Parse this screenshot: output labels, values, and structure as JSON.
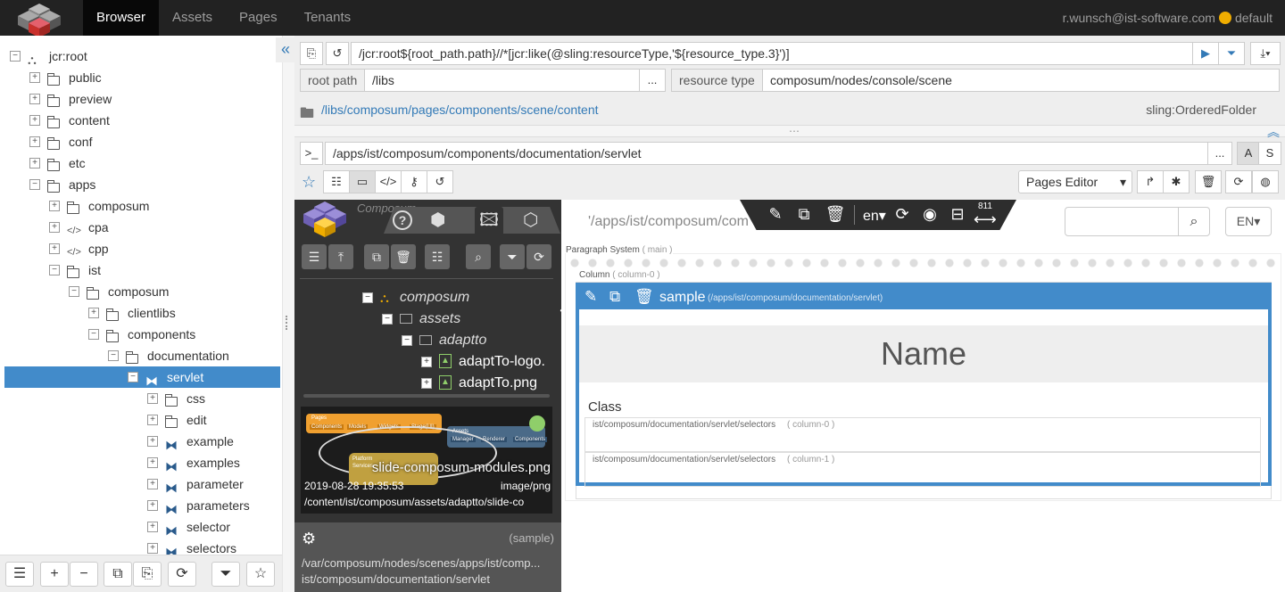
{
  "topnav": {
    "items": [
      "Browser",
      "Assets",
      "Pages",
      "Tenants"
    ],
    "user": "r.wunsch@ist-software.com",
    "tenant": "default"
  },
  "tree": {
    "rows": [
      {
        "label": "jcr:root",
        "depth": 0,
        "toggle": "−",
        "icon": "root-icon"
      },
      {
        "label": "public",
        "depth": 1,
        "toggle": "+",
        "icon": "folder-icon"
      },
      {
        "label": "preview",
        "depth": 1,
        "toggle": "+",
        "icon": "folder-icon"
      },
      {
        "label": "content",
        "depth": 1,
        "toggle": "+",
        "icon": "folder-icon"
      },
      {
        "label": "conf",
        "depth": 1,
        "toggle": "+",
        "icon": "folder-icon"
      },
      {
        "label": "etc",
        "depth": 1,
        "toggle": "+",
        "icon": "folder-icon"
      },
      {
        "label": "apps",
        "depth": 1,
        "toggle": "−",
        "icon": "folder-icon"
      },
      {
        "label": "composum",
        "depth": 2,
        "toggle": "+",
        "icon": "folder-icon"
      },
      {
        "label": "cpa",
        "depth": 2,
        "toggle": "+",
        "icon": "code-icon"
      },
      {
        "label": "cpp",
        "depth": 2,
        "toggle": "+",
        "icon": "code-icon"
      },
      {
        "label": "ist",
        "depth": 2,
        "toggle": "−",
        "icon": "folder-icon"
      },
      {
        "label": "composum",
        "depth": 3,
        "toggle": "−",
        "icon": "folder-icon"
      },
      {
        "label": "clientlibs",
        "depth": 4,
        "toggle": "+",
        "icon": "folder-icon"
      },
      {
        "label": "components",
        "depth": 4,
        "toggle": "−",
        "icon": "folder-icon"
      },
      {
        "label": "documentation",
        "depth": 5,
        "toggle": "−",
        "icon": "folder-icon"
      },
      {
        "label": "servlet",
        "depth": 6,
        "toggle": "−",
        "icon": "component-icon",
        "selected": true
      },
      {
        "label": "css",
        "depth": 7,
        "toggle": "+",
        "icon": "folder-icon"
      },
      {
        "label": "edit",
        "depth": 7,
        "toggle": "+",
        "icon": "folder-icon"
      },
      {
        "label": "example",
        "depth": 7,
        "toggle": "+",
        "icon": "component-icon"
      },
      {
        "label": "examples",
        "depth": 7,
        "toggle": "+",
        "icon": "component-icon"
      },
      {
        "label": "parameter",
        "depth": 7,
        "toggle": "+",
        "icon": "component-icon"
      },
      {
        "label": "parameters",
        "depth": 7,
        "toggle": "+",
        "icon": "component-icon"
      },
      {
        "label": "selector",
        "depth": 7,
        "toggle": "+",
        "icon": "component-icon"
      },
      {
        "label": "selectors",
        "depth": 7,
        "toggle": "+",
        "icon": "component-icon"
      }
    ],
    "toolbar": [
      "☰",
      "+",
      "−",
      "⧉",
      "⎘",
      "⟳",
      "⏷",
      "☆"
    ]
  },
  "query": {
    "expression": "/jcr:root${root_path.path}//*[jcr:like(@sling:resourceType,'${resource_type.3}')]",
    "root_path_label": "root path",
    "root_path_value": "/libs",
    "ellipsis": "...",
    "resource_type_label": "resource type",
    "resource_type_value": "composum/nodes/console/scene"
  },
  "current": {
    "path": "/libs/composum/pages/components/scene/content",
    "type": "sling:OrderedFolder"
  },
  "editor": {
    "path": "/apps/ist/composum/components/documentation/servlet",
    "ellipsis": "...",
    "a_label": "A",
    "s_label": "S",
    "view_select": "Pages Editor"
  },
  "composum": {
    "title": "Composum",
    "tree": [
      {
        "label": "composum",
        "toggle": "−",
        "icon": "sitemap-icon"
      },
      {
        "label": "assets",
        "toggle": "−",
        "icon": "folder-icon"
      },
      {
        "label": "adaptto",
        "toggle": "−",
        "icon": "folder-icon"
      },
      {
        "label": "adaptTo-logo.",
        "toggle": "+",
        "icon": "image-icon"
      },
      {
        "label": "adaptTo.png",
        "toggle": "+",
        "icon": "image-icon"
      }
    ],
    "preview": {
      "filename": "slide-composum-modules.png",
      "date": "2019-08-28 19:35:53",
      "mime": "image/png",
      "path": "/content/ist/composum/assets/adaptto/slide-co",
      "diagram_labels": [
        "Pages",
        "Components",
        "Models",
        "Widgets",
        "Stage(UI)",
        "Assets",
        "Manager",
        "Renderer",
        "Components",
        "Platform",
        "Services"
      ]
    },
    "context": "(sample)",
    "scene_path": "/var/composum/nodes/scenes/apps/ist/comp...",
    "resource": "ist/composum/documentation/servlet"
  },
  "page": {
    "path_display": "'/apps/ist/composum/com",
    "lang": "en",
    "width_indicator": "811",
    "search_placeholder": "",
    "lang_button": "EN",
    "paragraph_system": "Paragraph System",
    "paragraph_system_name": "( main )",
    "column": "Column",
    "column_name": "( column-0 )",
    "sample_title": "sample",
    "sample_path": "(/apps/ist/composum/documentation/servlet)",
    "name_heading": "Name",
    "class_label": "Class",
    "selector_rows": [
      {
        "path": "ist/composum/documentation/servlet/selectors",
        "name": "( column-0 )"
      },
      {
        "path": "ist/composum/documentation/servlet/selectors",
        "name": "( column-1 )"
      }
    ]
  }
}
